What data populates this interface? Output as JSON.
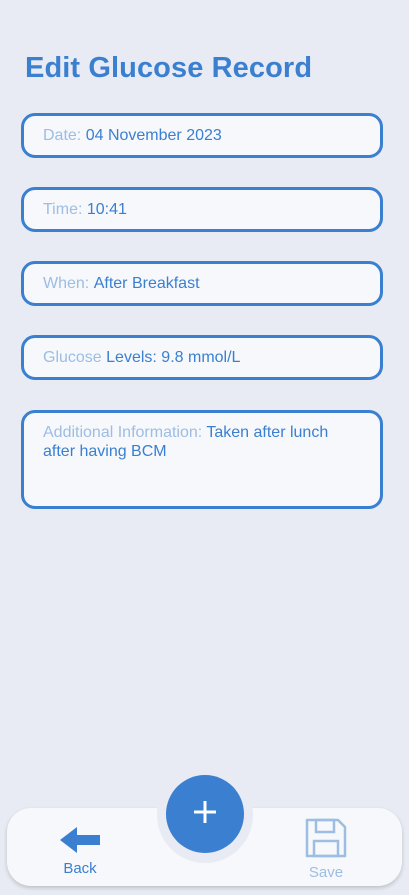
{
  "page": {
    "title": "Edit Glucose Record"
  },
  "fields": {
    "date": {
      "label": "Date:",
      "value": "04 November 2023"
    },
    "time": {
      "label": "Time:",
      "value": "10:41"
    },
    "when": {
      "label": "When:",
      "value": "After Breakfast"
    },
    "glucose": {
      "label": "Glucose",
      "value": "Levels: 9.8 mmol/L"
    },
    "additional": {
      "label": "Additional Information:",
      "value": "Taken after lunch after having BCM"
    }
  },
  "nav": {
    "back_label": "Back",
    "save_label": "Save",
    "add_icon": "plus-icon",
    "back_icon": "arrow-left-icon",
    "save_icon": "floppy-disk-icon"
  },
  "colors": {
    "accent": "#3a7fd0",
    "muted": "#9dbde3",
    "background": "#e8ebf3",
    "surface": "#f6f8fb"
  }
}
